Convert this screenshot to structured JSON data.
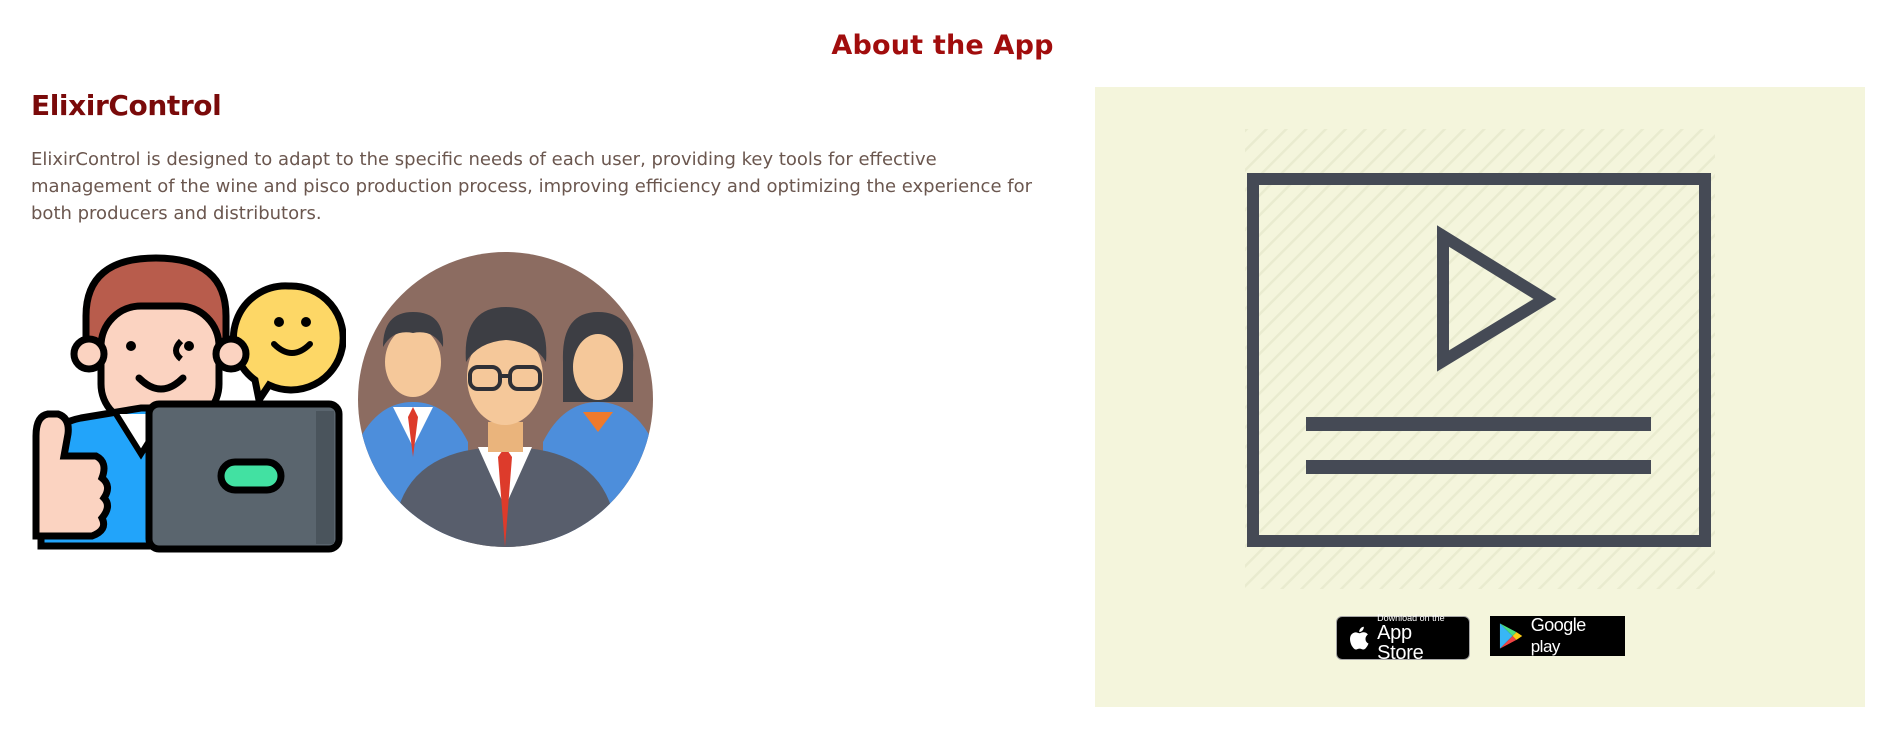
{
  "section": {
    "title": "About the App"
  },
  "app": {
    "name": "ElixirControl",
    "description": "ElixirControl is designed to adapt to the specific needs of each user, providing key tools for effective management of the wine and pisco production process, improving efficiency and optimizing the experience for both producers and distributors."
  },
  "illustrations": [
    {
      "icon": "happy-user-laptop-icon"
    },
    {
      "icon": "team-avatars-icon"
    }
  ],
  "media": {
    "video_icon": "video-play-icon",
    "panel_color": "#f4f5dc"
  },
  "store_badges": {
    "apple": {
      "small_label": "Download on the",
      "big_label": "App Store"
    },
    "google": {
      "label_google": "Google",
      "label_play": " play"
    }
  },
  "colors": {
    "title": "#a10d0d",
    "app_name": "#7a0a0a",
    "body_text": "#6b574f"
  }
}
